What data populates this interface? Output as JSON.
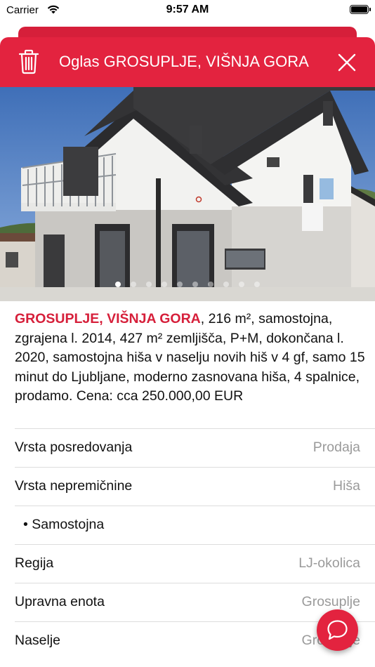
{
  "status_bar": {
    "carrier": "Carrier",
    "time": "9:57 AM",
    "wifi_icon": "wifi-icon",
    "battery_icon": "battery-icon"
  },
  "modal": {
    "title": "Oglas GROSUPLJE, VIŠNJA GORA",
    "delete_icon": "trash-icon",
    "close_icon": "close-icon",
    "accent_color": "#e3233f"
  },
  "gallery": {
    "image": "house-photo",
    "page_count": 10,
    "active_page": 1
  },
  "description": {
    "location": "GROSUPLJE, VIŠNJA GORA",
    "text": ", 216 m², samostojna, zgrajena l. 2014, 427 m² zemljišča, P+M, dokončana l. 2020, samostojna hiša v naselju novih hiš v 4 gf, samo 15 minut do Ljubljane, moderno zasnovana hiša, 4 spalnice, prodamo. Cena: cca 250.000,00 EUR"
  },
  "details": [
    {
      "label": "Vrsta posredovanja",
      "value": "Prodaja"
    },
    {
      "label": "Vrsta nepremičnine",
      "value": "Hiša"
    },
    {
      "label": "• Samostojna",
      "value": ""
    },
    {
      "label": "Regija",
      "value": "LJ-okolica"
    },
    {
      "label": "Upravna enota",
      "value": "Grosuplje"
    },
    {
      "label": "Naselje",
      "value": "Grosuplje"
    }
  ],
  "chat_button": {
    "icon": "chat-bubble-icon"
  }
}
